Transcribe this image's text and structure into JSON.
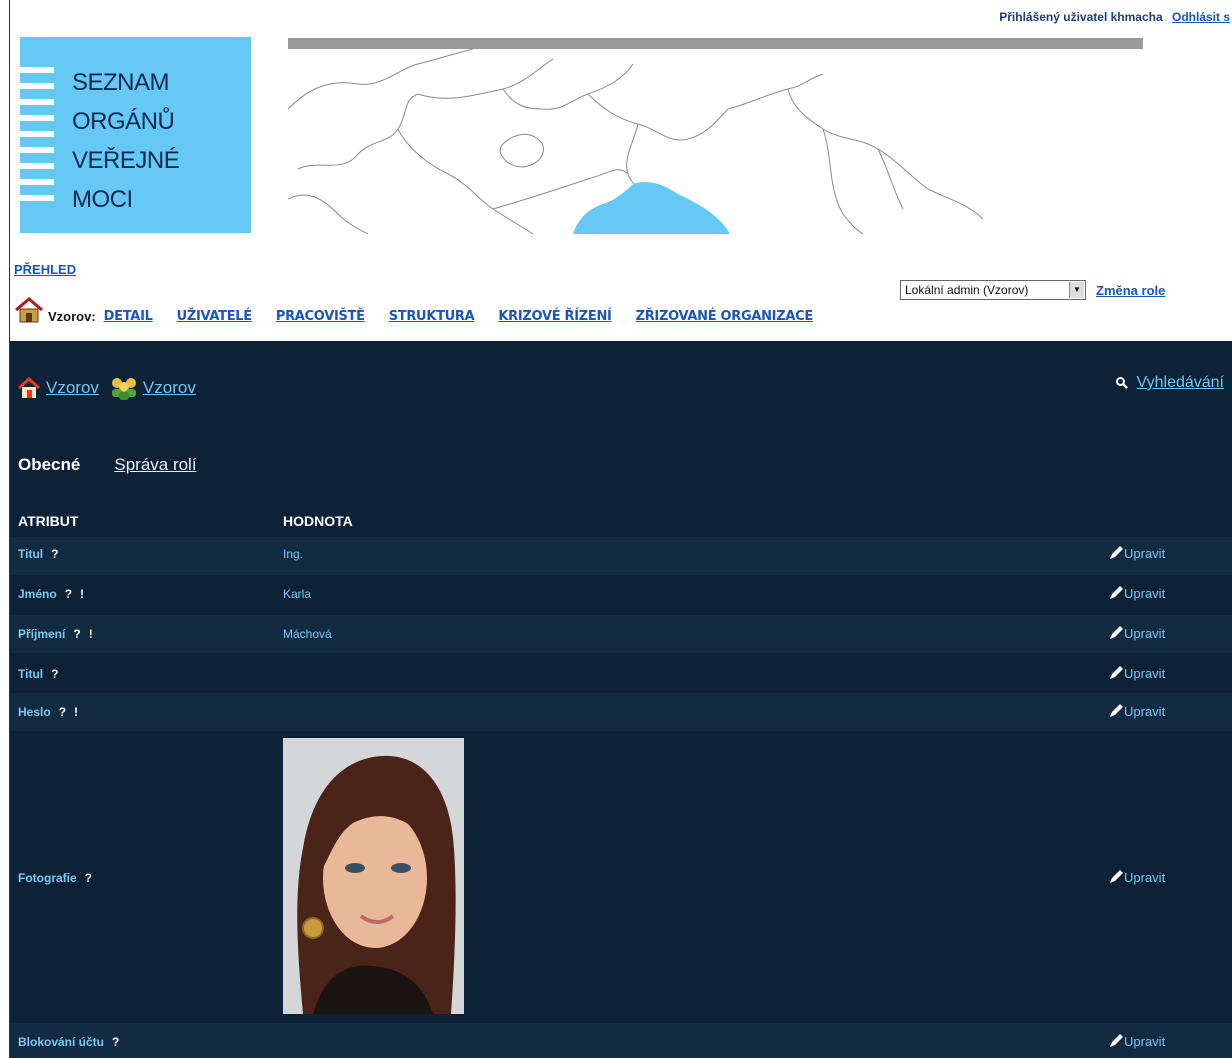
{
  "header": {
    "logged_user": "Přihlášený uživatel khmacha",
    "logout": "Odhlásit s",
    "logo_lines": [
      "SEZNAM",
      "ORGÁNŮ",
      "VEŘEJNÉ",
      "MOCI"
    ]
  },
  "nav": {
    "overview": "PŘEHLED",
    "context_label": "Vzorov:",
    "links": [
      "DETAIL",
      "UŽIVATELÉ",
      "PRACOVIŠTĚ",
      "STRUKTURA",
      "KRIZOVÉ ŘÍZENÍ",
      "ZŘIZOVANÉ ORGANIZACE"
    ],
    "role_select": "Lokální admin (Vzorov)",
    "role_change": "Změna role"
  },
  "breadcrumbs": [
    "Vzorov",
    "Vzorov"
  ],
  "search_link": "Vyhledávání",
  "tabs": {
    "active": "Obecné",
    "other": "Správa rolí"
  },
  "table": {
    "headers": {
      "attr": "ATRIBUT",
      "value": "HODNOTA"
    },
    "edit_label": "Upravit",
    "rows": [
      {
        "attr": "Titul",
        "q": "?",
        "ex": "",
        "value": "Ing."
      },
      {
        "attr": "Jméno",
        "q": "?",
        "ex": "!",
        "value": "Karla"
      },
      {
        "attr": "Příjmení",
        "q": "?",
        "ex": "!",
        "value": "Máchová"
      },
      {
        "attr": "Titul",
        "q": "?",
        "ex": "",
        "value": ""
      },
      {
        "attr": "Heslo",
        "q": "?",
        "ex": "!",
        "value": ""
      },
      {
        "attr": "Fotografie",
        "q": "?",
        "ex": "",
        "value": ""
      },
      {
        "attr": "Blokování účtu",
        "q": "?",
        "ex": "",
        "value": ""
      }
    ]
  },
  "colors": {
    "dark_bg": "#0e2237",
    "accent": "#6ec6f2",
    "logo_bg": "#66c8f5",
    "map_highlight": "#66c8f5"
  }
}
